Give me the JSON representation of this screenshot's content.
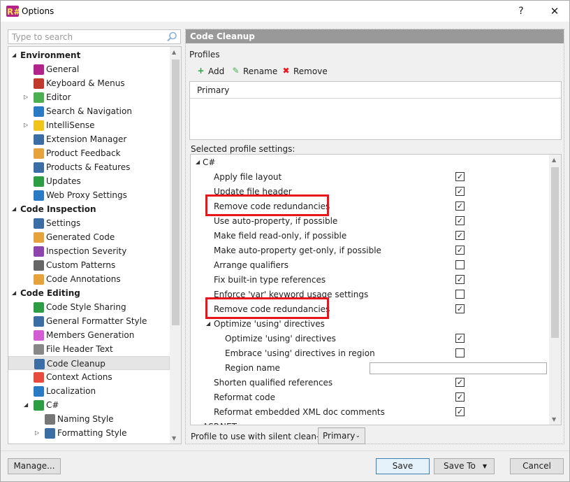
{
  "window": {
    "title": "Options",
    "help_glyph": "?",
    "close_glyph": "✕"
  },
  "search": {
    "placeholder": "Type to search"
  },
  "tree": [
    {
      "label": "Environment",
      "header": true,
      "caret": "◢"
    },
    {
      "label": "General",
      "icon": "resharper-icon",
      "color": "#b2238c"
    },
    {
      "label": "Keyboard & Menus",
      "icon": "keyboard-icon",
      "color": "#c0392b"
    },
    {
      "label": "Editor",
      "icon": "pencil-icon",
      "color": "#4caf50",
      "caret": "▷"
    },
    {
      "label": "Search & Navigation",
      "icon": "magnifier-icon",
      "color": "#2b7bc4"
    },
    {
      "label": "IntelliSense",
      "icon": "lightbulb-icon",
      "color": "#f0c419",
      "caret": "▷"
    },
    {
      "label": "Extension Manager",
      "icon": "extension-icon",
      "color": "#3a6ea5"
    },
    {
      "label": "Product Feedback",
      "icon": "envelope-icon",
      "color": "#e6a23c"
    },
    {
      "label": "Products & Features",
      "icon": "grid-icon",
      "color": "#3a6ea5"
    },
    {
      "label": "Updates",
      "icon": "updates-icon",
      "color": "#2e9e44"
    },
    {
      "label": "Web Proxy Settings",
      "icon": "globe-icon",
      "color": "#2b7bc4"
    },
    {
      "label": "Code Inspection",
      "header": true,
      "caret": "◢"
    },
    {
      "label": "Settings",
      "icon": "inspector-icon",
      "color": "#3a6ea5"
    },
    {
      "label": "Generated Code",
      "icon": "generated-code-icon",
      "color": "#e6a23c"
    },
    {
      "label": "Inspection Severity",
      "icon": "severity-icon",
      "color": "#8e44ad"
    },
    {
      "label": "Custom Patterns",
      "icon": "patterns-icon",
      "color": "#666666"
    },
    {
      "label": "Code Annotations",
      "icon": "annotations-icon",
      "color": "#e6a23c"
    },
    {
      "label": "Code Editing",
      "header": true,
      "caret": "◢"
    },
    {
      "label": "Code Style Sharing",
      "icon": "style-sharing-icon",
      "color": "#2e9e44"
    },
    {
      "label": "General Formatter Style",
      "icon": "formatter-icon",
      "color": "#3a6ea5"
    },
    {
      "label": "Members Generation",
      "icon": "members-icon",
      "color": "#d35ed3"
    },
    {
      "label": "File Header Text",
      "icon": "file-icon",
      "color": "#888888"
    },
    {
      "label": "Code Cleanup",
      "icon": "broom-icon",
      "color": "#3a6ea5",
      "selected": true
    },
    {
      "label": "Context Actions",
      "icon": "wrench-icon",
      "color": "#e74c3c"
    },
    {
      "label": "Localization",
      "icon": "localization-icon",
      "color": "#2b7bc4"
    },
    {
      "label": "C#",
      "icon": "csharp-icon",
      "color": "#2e9e44",
      "caret": "◢"
    },
    {
      "label": "Naming Style",
      "icon": "naming-icon",
      "color": "#777777"
    },
    {
      "label": "Formatting Style",
      "icon": "formatting-icon",
      "color": "#3a6ea5",
      "caret": "▷"
    }
  ],
  "panel": {
    "header": "Code Cleanup",
    "profiles_label": "Profiles",
    "toolbar": [
      {
        "label": "Add",
        "icon": "add-icon",
        "glyph": "+",
        "color": "#2e9e44"
      },
      {
        "label": "Rename",
        "icon": "rename-pencil-icon",
        "glyph": "✎",
        "color": "#4caf50"
      },
      {
        "label": "Remove",
        "icon": "remove-icon",
        "glyph": "✖",
        "color": "#e8151b"
      }
    ],
    "profile_header": "Primary",
    "selected_settings_label": "Selected profile settings:",
    "settings": [
      {
        "label": "C#",
        "caret": "◢",
        "indent": 0
      },
      {
        "label": "Apply file layout",
        "checked": true,
        "indent": 1
      },
      {
        "label": "Update file header",
        "checked": true,
        "indent": 1
      },
      {
        "label": "Remove code redundancies",
        "checked": true,
        "indent": 1,
        "highlight": true
      },
      {
        "label": "Use auto-property, if possible",
        "checked": true,
        "indent": 1
      },
      {
        "label": "Make field read-only, if possible",
        "checked": true,
        "indent": 1
      },
      {
        "label": "Make auto-property get-only, if possible",
        "checked": true,
        "indent": 1
      },
      {
        "label": "Arrange qualifiers",
        "checked": false,
        "indent": 1
      },
      {
        "label": "Fix built-in type references",
        "checked": true,
        "indent": 1
      },
      {
        "label": "Enforce 'var' keyword usage settings",
        "checked": false,
        "indent": 1
      },
      {
        "label": "Remove code redundancies",
        "checked": true,
        "indent": 1,
        "highlight": true
      },
      {
        "label": "Optimize 'using' directives",
        "caret": "◢",
        "indent": 1
      },
      {
        "label": "Optimize 'using' directives",
        "checked": true,
        "indent": 2
      },
      {
        "label": "Embrace 'using' directives in region",
        "checked": false,
        "indent": 2
      },
      {
        "label": "Region name",
        "input": true,
        "indent": 2
      },
      {
        "label": "Shorten qualified references",
        "checked": true,
        "indent": 1
      },
      {
        "label": "Reformat code",
        "checked": true,
        "indent": 1
      },
      {
        "label": "Reformat embedded XML doc comments",
        "checked": true,
        "indent": 1
      },
      {
        "label": "ASP.NET",
        "caret": "▷",
        "indent": 0
      }
    ],
    "silent_label": "Profile to use with silent clean-up:",
    "silent_value": "Primary"
  },
  "buttons": {
    "manage": "Manage...",
    "save": "Save",
    "save_to": "Save To",
    "cancel": "Cancel"
  }
}
